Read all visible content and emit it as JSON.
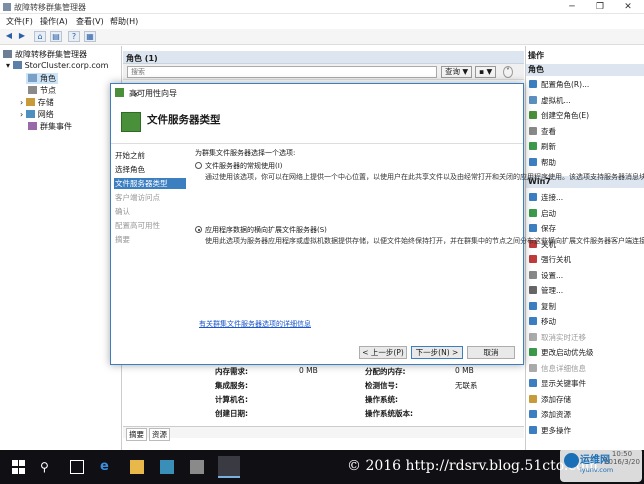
{
  "window": {
    "title": "故障转移群集管理器",
    "controls": [
      "─",
      "❐",
      "✕"
    ]
  },
  "menu": [
    "文件(F)",
    "操作(A)",
    "查看(V)",
    "帮助(H)"
  ],
  "tree": {
    "root": "故障转移群集管理器",
    "cluster": "StorCluster.corp.com",
    "items": [
      "角色",
      "节点",
      "存储",
      "网络",
      "群集事件"
    ]
  },
  "roles_header": "角色 (1)",
  "filter": {
    "placeholder": "搜索",
    "query_label": "查询",
    "dropdown": "▼"
  },
  "info": {
    "rows": [
      [
        "内存需求:",
        "0 MB",
        "分配的内存:",
        "0 MB"
      ],
      [
        "集成服务:",
        "",
        "检测信号:",
        "无联系"
      ],
      [
        "计算机名:",
        "",
        "操作系统:",
        ""
      ],
      [
        "创建日期:",
        "",
        "操作系统版本:",
        ""
      ]
    ]
  },
  "bottom_tabs": [
    "摘要",
    "资源"
  ],
  "actions": {
    "header1": "操作",
    "section1": "角色",
    "items1": [
      "配置角色(R)...",
      "虚拟机...",
      "创建空角色(E)",
      "查看",
      "刷新",
      "帮助"
    ],
    "section2": "Win7",
    "items2": [
      "连接...",
      "启动",
      "保存",
      "关机",
      "强行关机",
      "设置...",
      "管理...",
      "复制",
      "移动",
      "取消实时迁移",
      "更改启动优先级",
      "信息详细信息",
      "显示关键事件",
      "添加存储",
      "添加资源",
      "更多操作"
    ]
  },
  "dialog": {
    "title": "高可用性向导",
    "heading": "文件服务器类型",
    "close": "✕",
    "steps": [
      "开始之前",
      "选择角色",
      "文件服务器类型",
      "客户端访问点",
      "确认",
      "配置高可用性",
      "摘要"
    ],
    "prompt": "为群集文件服务器选择一个选项:",
    "option1": "文件服务器的常规使用(I)",
    "desc1": "通过使用该选项，你可以在网络上提供一个中心位置，以使用户在此共享文件以及由经常打开和关闭的应用程序使用。该选项支持服务器消息块(SMB)和网络文件系统(NFS)协议。它还支持重复数据删除、文件服务器资源管理器、DFS 复制以及其他文件服务角色服务。",
    "option2": "应用程序数据的横向扩展文件服务器(S)",
    "desc2": "使用此选项为服务器应用程序或虚拟机数据提供存储，以便文件始终保持打开，并在群集中的节点之间分布这些横向扩展文件服务器客户端连接，以提供更高的吞吐量。此选项支持 SMB 协议。它不支持 NFS 协议、DFS 复制和文件服务器资源管理器。",
    "link": "有关群集文件服务器选项的详细信息",
    "buttons": {
      "prev": "< 上一步(P)",
      "next": "下一步(N) >",
      "cancel": "取消"
    }
  },
  "watermark": "© 2016 http://rdsrv.blog.51cto.com",
  "clock": {
    "time": "10:50",
    "date": "2016/3/20"
  },
  "logo": {
    "name": "运维网",
    "sub": "iyunv.com"
  },
  "colors": {
    "accent": "#3c7fc1",
    "taskbar": "#101014"
  }
}
